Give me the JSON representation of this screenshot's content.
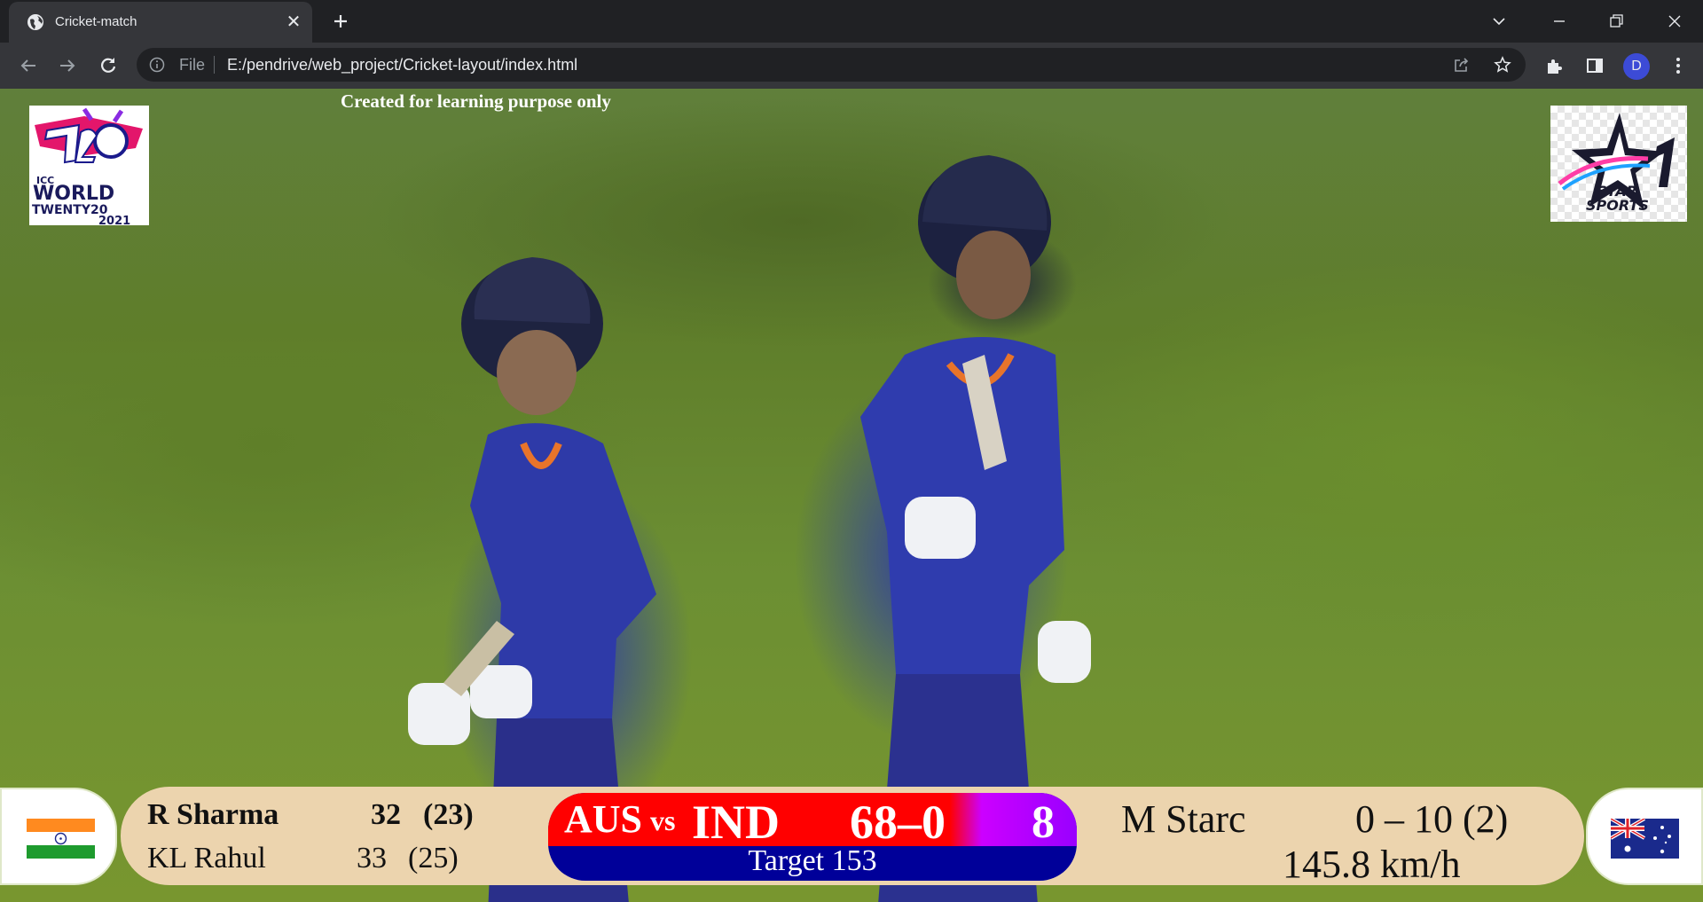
{
  "browser": {
    "tab_title": "Cricket-match",
    "omnibox_scheme": "File",
    "url": "E:/pendrive/web_project/Cricket-layout/index.html",
    "profile_initial": "D",
    "icons": [
      "globe-icon",
      "close-icon",
      "plus-icon",
      "back-arrow-icon",
      "forward-arrow-icon",
      "reload-icon",
      "info-icon",
      "share-icon",
      "star-icon",
      "puzzle-icon",
      "side-panel-icon",
      "more-vert-icon",
      "minimize-icon",
      "restore-icon",
      "window-close-icon",
      "tab-search-icon"
    ]
  },
  "page": {
    "credit": "Created for learning purpose only",
    "logos": [
      "t20-world-cup-logo",
      "star-sports-1-logo"
    ]
  },
  "scoreboard": {
    "batsmen": [
      {
        "name": "R Sharma",
        "runs": "32",
        "balls": "(23)"
      },
      {
        "name": "KL Rahul",
        "runs": "33",
        "balls": "(25)"
      }
    ],
    "team1": "AUS",
    "vs": "vs",
    "team2": "IND",
    "score": "68–0",
    "overs": "8",
    "target": "Target 153",
    "bowler": {
      "name": "M Starc",
      "figures": "0 – 10  (2)"
    },
    "speed": "145.8 km/h",
    "flags": [
      "india-flag",
      "australia-flag"
    ]
  },
  "colors": {
    "board_bg": "#ecd4ae",
    "score_red": "#ff0000",
    "score_purple": "#9900ff",
    "score_blue": "#000099"
  }
}
